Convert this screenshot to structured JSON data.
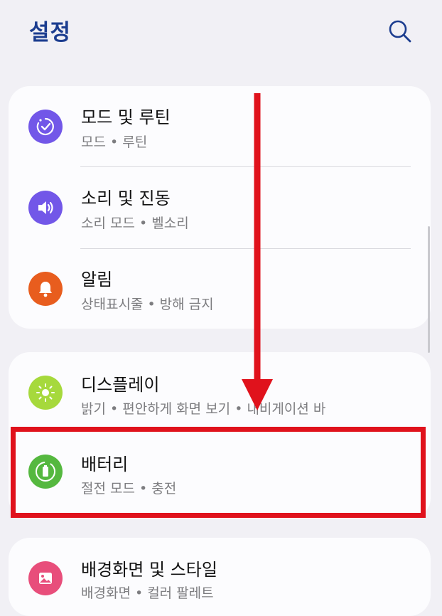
{
  "header": {
    "title": "설정",
    "search_icon": "search-icon"
  },
  "cards": [
    {
      "items": [
        {
          "label": "모드 및 루틴",
          "sub": "모드 • 루틴",
          "icon": "modes-routines-icon",
          "color": "#7257e8"
        },
        {
          "label": "소리 및 진동",
          "sub": "소리 모드 • 벨소리",
          "icon": "speaker-icon",
          "color": "#7257e8"
        },
        {
          "label": "알림",
          "sub": "상태표시줄 • 방해 금지",
          "icon": "bell-icon",
          "color": "#e85d1e"
        }
      ]
    },
    {
      "items": [
        {
          "label": "디스플레이",
          "sub": "밝기 • 편안하게 화면 보기 • 내비게이션 바",
          "icon": "brightness-icon",
          "color": "#a6d93c"
        },
        {
          "label": "배터리",
          "sub": "절전 모드 • 충전",
          "icon": "battery-icon",
          "color": "#55b83f"
        }
      ]
    },
    {
      "items": [
        {
          "label": "배경화면 및 스타일",
          "sub": "배경화면 • 컬러 팔레트",
          "icon": "wallpaper-icon",
          "color": "#e84e7b"
        }
      ]
    }
  ],
  "annotation": {
    "arrow_color": "#e0121c",
    "highlight_color": "#e0121c"
  }
}
